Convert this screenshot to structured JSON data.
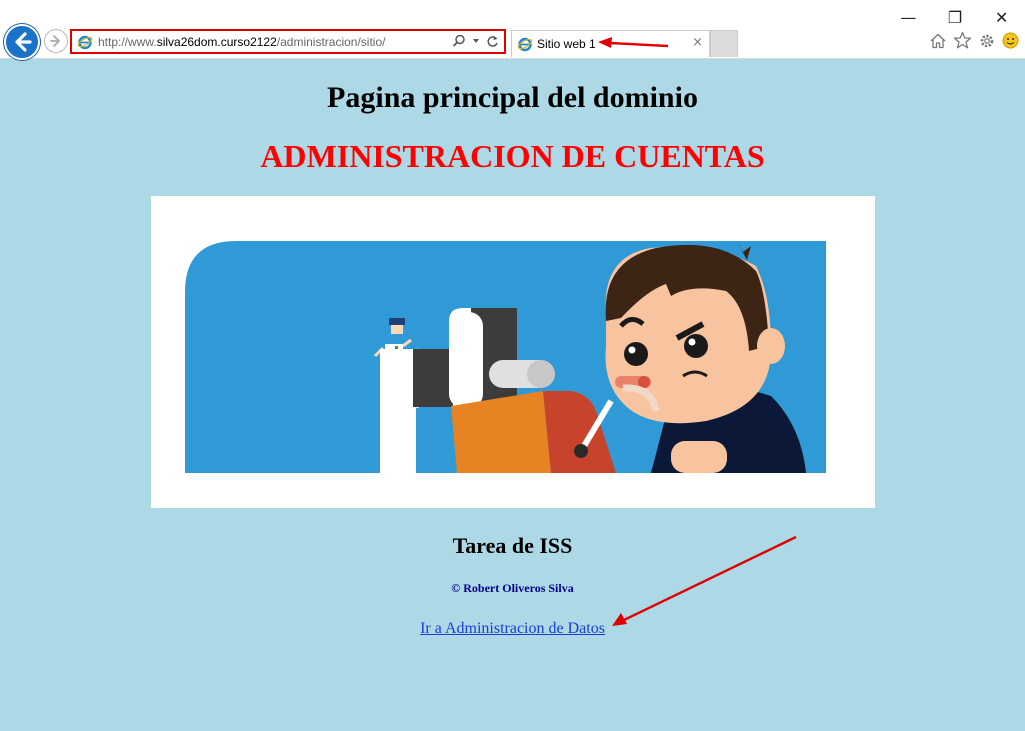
{
  "browser": {
    "url_prefix": "http://www.",
    "url_domain": "silva26dom.curso2122",
    "url_path": "/administracion/sitio/",
    "tab_title": "Sitio web 1",
    "tab_close": "×",
    "window_controls": {
      "minimize": "—",
      "restore": "❐",
      "close": "✕"
    },
    "icons": [
      "back-icon",
      "forward-icon",
      "ie-logo-icon",
      "search-icon",
      "refresh-icon",
      "home-icon",
      "favorites-star-icon",
      "settings-gear-icon",
      "smiley-feedback-icon"
    ]
  },
  "page": {
    "title": "Pagina principal del dominio",
    "subtitle": "ADMINISTRACION DE CUENTAS",
    "section_title": "Tarea de ISS",
    "copyright": "© Robert Oliveros Silva",
    "link_text": "Ir a Administracion de Datos"
  },
  "colors": {
    "page_background": "#add8e6",
    "subtitle": "#ff0000",
    "copyright": "#00008b",
    "annotation_red": "#e00000",
    "banner_blue": "#2f9ad6"
  }
}
